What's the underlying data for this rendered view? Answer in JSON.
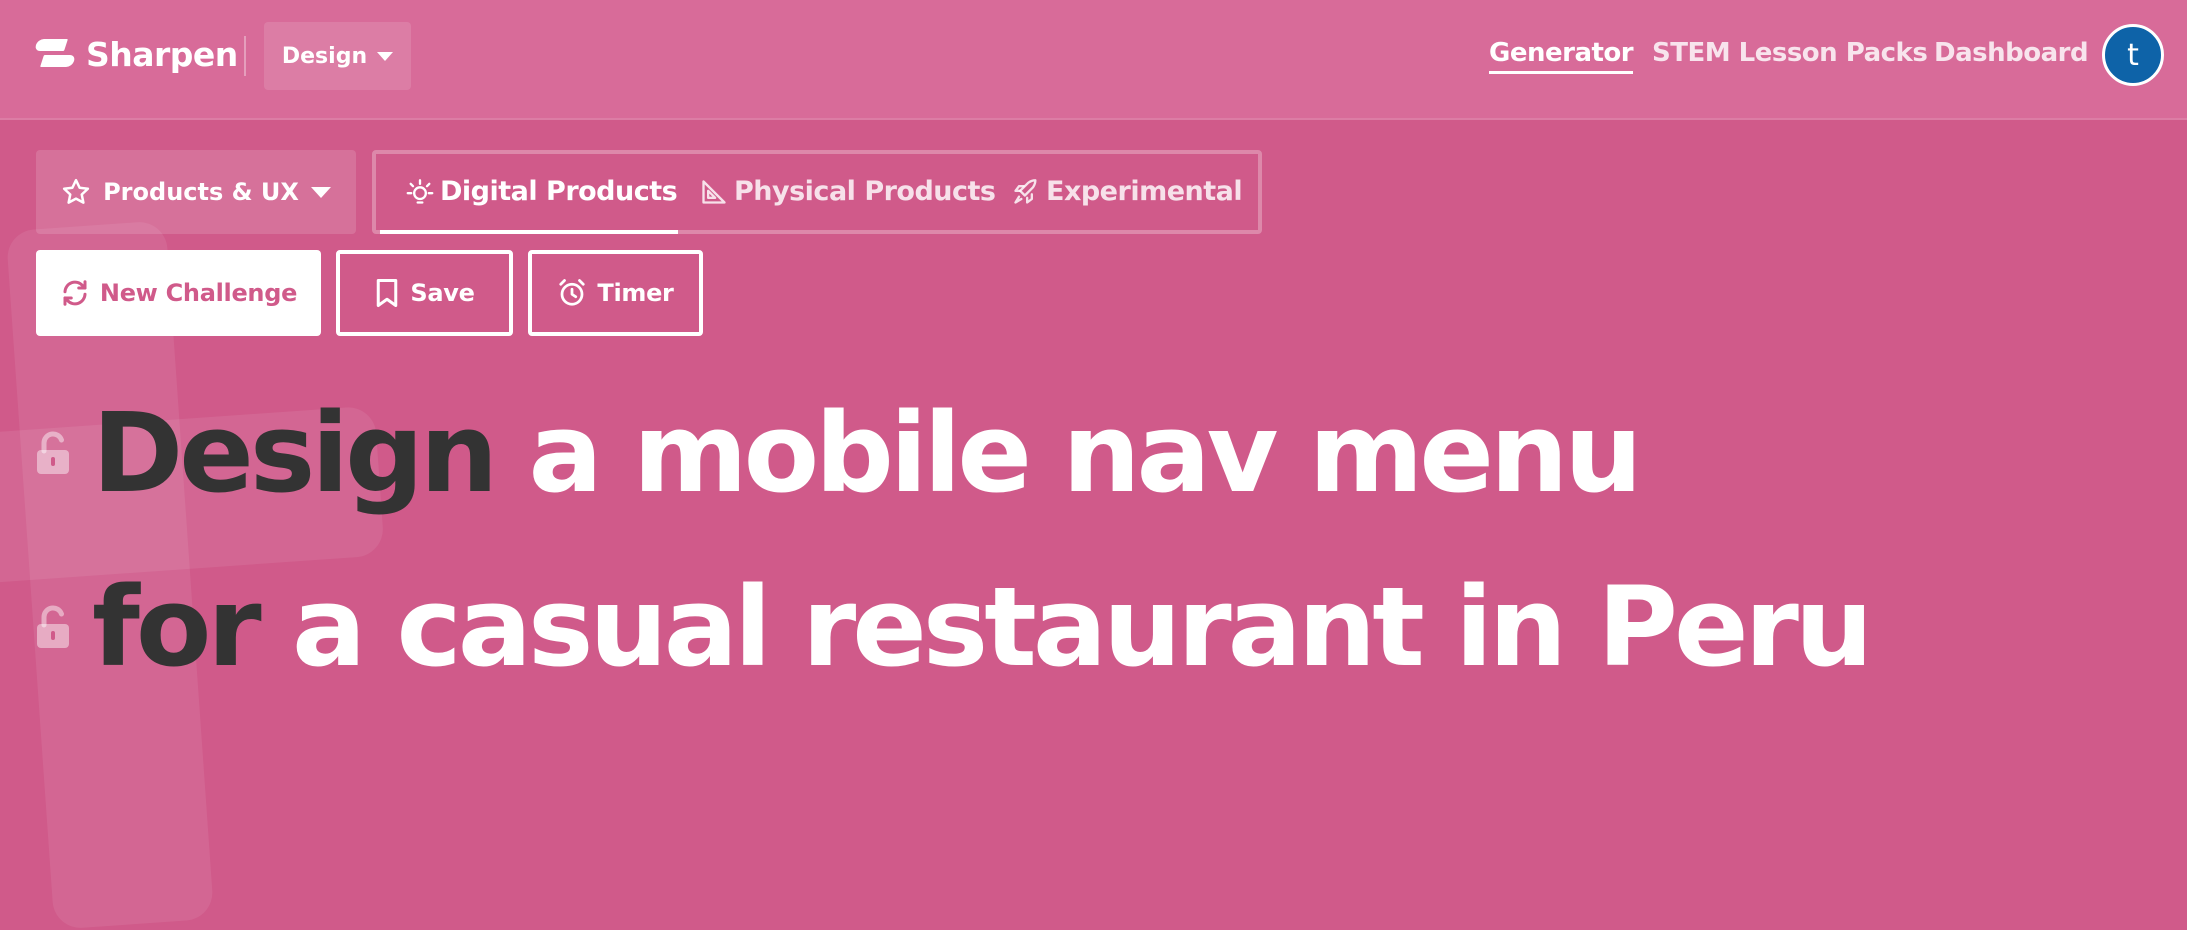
{
  "app": {
    "name": "Sharpen"
  },
  "header": {
    "dropdown": "Design",
    "nav": [
      {
        "label": "Generator",
        "active": true
      },
      {
        "label": "STEM Lesson Packs",
        "active": false
      },
      {
        "label": "Dashboard",
        "active": false
      }
    ],
    "avatar_initial": "t"
  },
  "category": {
    "label": "Products & UX",
    "icon": "star-icon"
  },
  "tabs": [
    {
      "label": "Digital Products",
      "icon": "light-bulb-icon",
      "active": true
    },
    {
      "label": "Physical Products",
      "icon": "triangle-ruler-icon",
      "active": false
    },
    {
      "label": "Experimental",
      "icon": "rocket-icon",
      "active": false
    }
  ],
  "actions": {
    "new_challenge": "New Challenge",
    "save": "Save",
    "timer": "Timer"
  },
  "prompt": {
    "line1": {
      "verb": "Design",
      "rest": "a mobile nav menu"
    },
    "line2": {
      "verb": "for",
      "rest": "a casual restaurant in Peru"
    }
  },
  "colors": {
    "background": "#d05a8a",
    "header": "#d86b99",
    "avatar": "#0e63a8",
    "verb_text": "#333333"
  }
}
